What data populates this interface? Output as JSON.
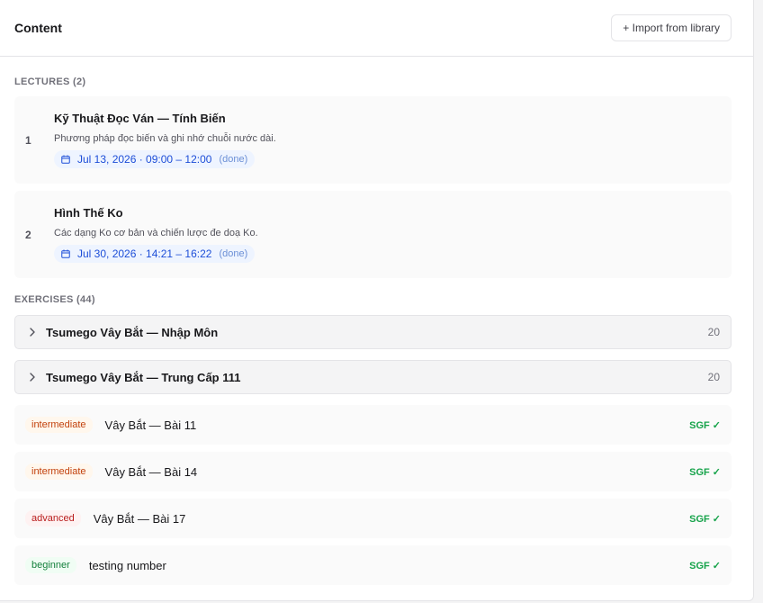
{
  "header": {
    "title": "Content",
    "import_label": "+ Import from library"
  },
  "lectures": {
    "label": "LECTURES (2)",
    "items": [
      {
        "number": "1",
        "title": "Kỹ Thuật Đọc Ván — Tính Biến",
        "description": "Phương pháp đọc biến và ghi nhớ chuỗi nước dài.",
        "schedule": "Jul 13, 2026 · 09:00 – 12:00",
        "status": "(done)"
      },
      {
        "number": "2",
        "title": "Hình Thế Ko",
        "description": "Các dạng Ko cơ bản và chiến lược đe doạ Ko.",
        "schedule": "Jul 30, 2026 · 14:21 – 16:22",
        "status": "(done)"
      }
    ]
  },
  "exercises": {
    "label": "EXERCISES (44)",
    "groups": [
      {
        "title": "Tsumego Vây Bắt — Nhập Môn",
        "count": "20"
      },
      {
        "title": "Tsumego Vây Bắt — Trung Cấp 111",
        "count": "20"
      }
    ],
    "items": [
      {
        "level": "intermediate",
        "title": "Vây Bắt — Bài 11",
        "sgf": "SGF ✓"
      },
      {
        "level": "intermediate",
        "title": "Vây Bắt — Bài 14",
        "sgf": "SGF ✓"
      },
      {
        "level": "advanced",
        "title": "Vây Bắt — Bài 17",
        "sgf": "SGF ✓"
      },
      {
        "level": "beginner",
        "title": "testing number",
        "sgf": "SGF ✓"
      }
    ]
  },
  "colors": {
    "accent_blue": "#1d4ed8",
    "intermediate": "#c2410c",
    "advanced": "#b91c1c",
    "beginner": "#15803d",
    "sgf_ok": "#16a34a"
  }
}
